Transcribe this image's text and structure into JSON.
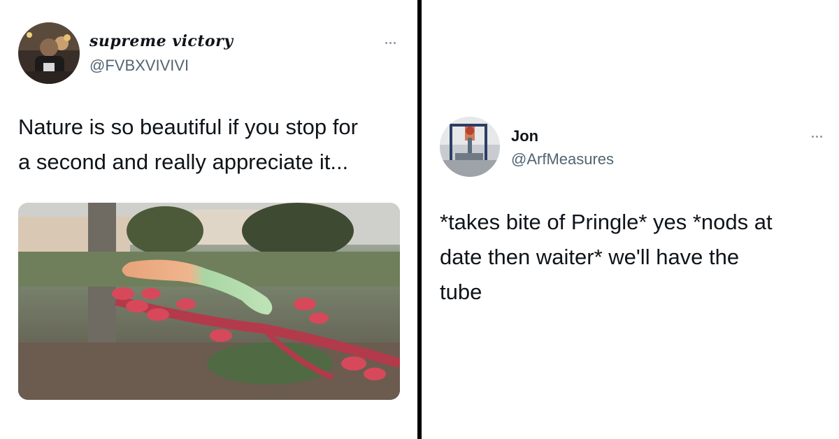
{
  "left_tweet": {
    "display_name": "supreme victory",
    "handle": "@FVBXVIVIVI",
    "text_lines": [
      "Nature is so beautiful if you stop for",
      "a second and really appreciate it..."
    ],
    "more_icon": "more-horizontal-icon",
    "media_description_icon": "photo-icon"
  },
  "right_tweet": {
    "display_name": "Jon",
    "handle": "@ArfMeasures",
    "text_lines": [
      "*takes bite of Pringle* yes *nods at",
      "date then waiter* we'll have the",
      "tube"
    ],
    "more_icon": "more-horizontal-icon"
  },
  "colors": {
    "text": "#0f1419",
    "secondary": "#536471",
    "divider": "#000000",
    "background": "#ffffff"
  }
}
